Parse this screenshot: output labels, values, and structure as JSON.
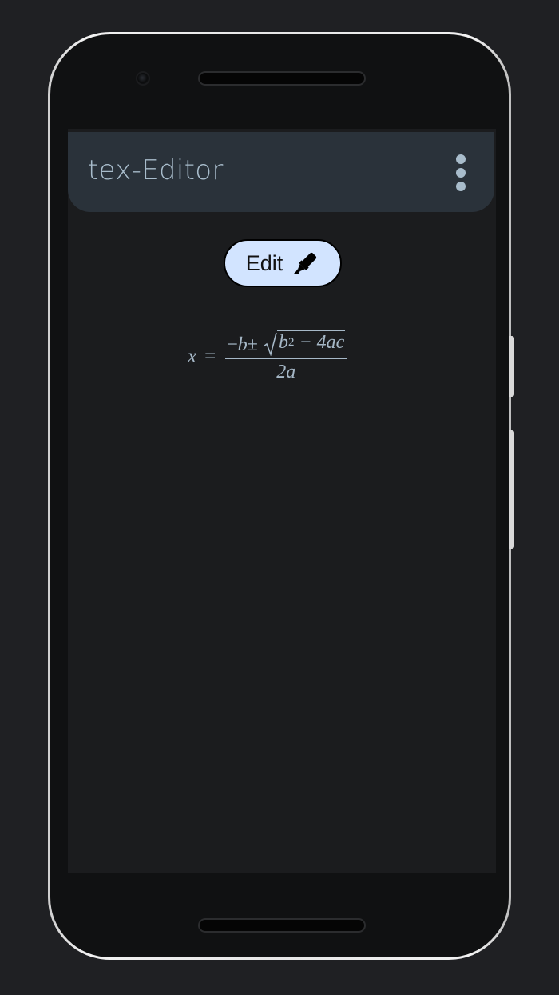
{
  "app": {
    "title": "tex-Editor"
  },
  "toolbar": {
    "menu_icon": "more-vertical-icon"
  },
  "editor": {
    "edit_label": "Edit",
    "edit_icon": "marker-icon"
  },
  "formula": {
    "lhs": "x",
    "equals": "=",
    "numerator_minus": "−",
    "numerator_b": "b",
    "plus_minus": " ± ",
    "radicand_base": "b",
    "radicand_exponent": "2",
    "radicand_rest": " − 4ac",
    "denominator": "2a"
  },
  "colors": {
    "background": "#1b1c1e",
    "app_bar": "#2a323a",
    "accent_text": "#a8bccb",
    "edit_button": "#d2e4ff"
  }
}
